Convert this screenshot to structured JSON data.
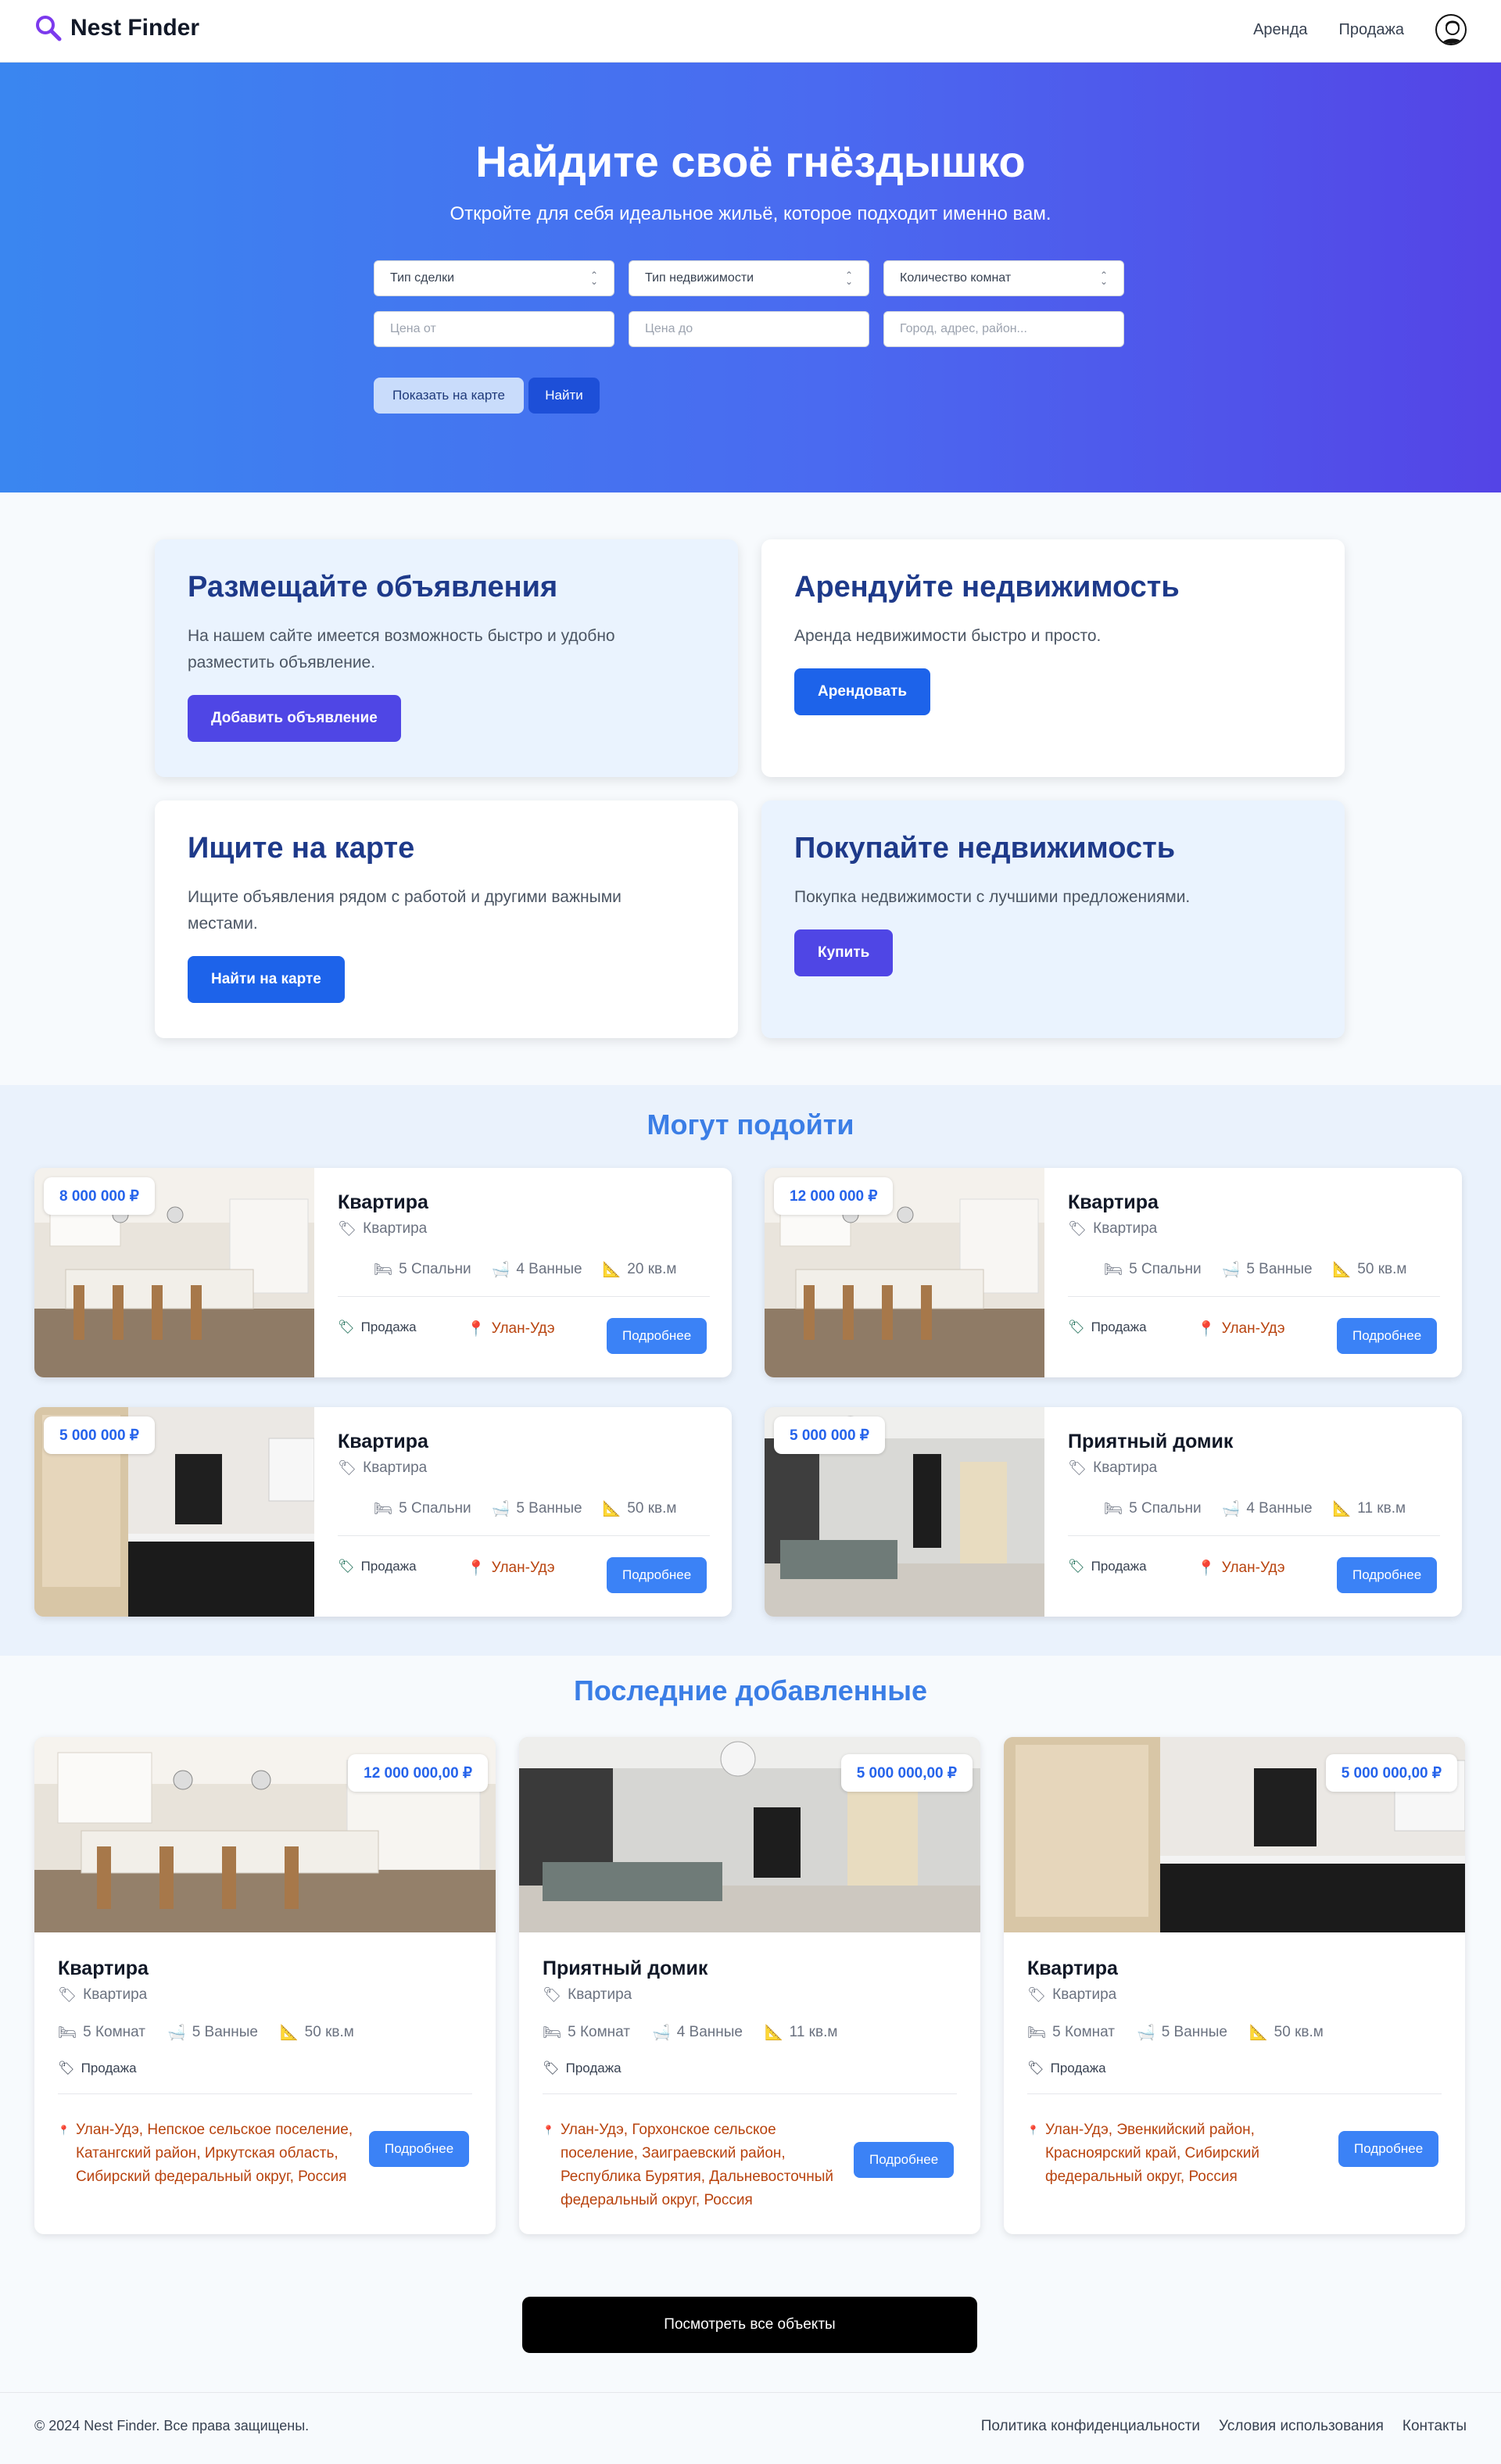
{
  "nav": {
    "logo_text": "Nest Finder",
    "links": [
      "Аренда",
      "Продажа"
    ]
  },
  "hero": {
    "title": "Найдите своё гнёздышко",
    "subtitle": "Откройте для себя идеальное жильё, которое подходит именно вам.",
    "selects": [
      "Тип сделки",
      "Тип недвижимости",
      "Количество комнат"
    ],
    "inputs": [
      "Цена от",
      "Цена до",
      "Город, адрес, район..."
    ],
    "map_button": "Показать на карте",
    "find_button": "Найти"
  },
  "promos": [
    {
      "title": "Размещайте объявления",
      "text": "На нашем сайте имеется возможность быстро и удобно разместить объявление.",
      "button": "Добавить объявление"
    },
    {
      "title": "Арендуйте недвижимость",
      "text": "Аренда недвижимости быстро и просто.",
      "button": "Арендовать"
    },
    {
      "title": "Ищите на карте",
      "text": "Ищите объявления рядом с работой и другими важными местами.",
      "button": "Найти на карте"
    },
    {
      "title": "Покупайте недвижимость",
      "text": "Покупка недвижимости с лучшими предложениями.",
      "button": "Купить"
    }
  ],
  "suggested": {
    "title": "Могут подойти",
    "cards": [
      {
        "price": "8 000 000 ₽",
        "title": "Квартира",
        "type": "Квартира",
        "bedrooms": "5 Спальни",
        "baths": "4 Ванные",
        "area": "20 кв.м",
        "deal": "Продажа",
        "city": "Улан-Удэ",
        "button": "Подробнее"
      },
      {
        "price": "12 000 000 ₽",
        "title": "Квартира",
        "type": "Квартира",
        "bedrooms": "5 Спальни",
        "baths": "5 Ванные",
        "area": "50 кв.м",
        "deal": "Продажа",
        "city": "Улан-Удэ",
        "button": "Подробнее"
      },
      {
        "price": "5 000 000 ₽",
        "title": "Квартира",
        "type": "Квартира",
        "bedrooms": "5 Спальни",
        "baths": "5 Ванные",
        "area": "50 кв.м",
        "deal": "Продажа",
        "city": "Улан-Удэ",
        "button": "Подробнее"
      },
      {
        "price": "5 000 000 ₽",
        "title": "Приятный домик",
        "type": "Квартира",
        "bedrooms": "5 Спальни",
        "baths": "4 Ванные",
        "area": "11 кв.м",
        "deal": "Продажа",
        "city": "Улан-Удэ",
        "button": "Подробнее"
      }
    ]
  },
  "latest": {
    "title": "Последние добавленные",
    "cards": [
      {
        "price": "12 000 000,00 ₽",
        "title": "Квартира",
        "type": "Квартира",
        "rooms": "5 Комнат",
        "baths": "5 Ванные",
        "area": "50 кв.м",
        "deal": "Продажа",
        "address": "Улан-Удэ, Непское сельское поселение, Катангский район, Иркутская область, Сибирский федеральный округ, Россия",
        "button": "Подробнее"
      },
      {
        "price": "5 000 000,00 ₽",
        "title": "Приятный домик",
        "type": "Квартира",
        "rooms": "5 Комнат",
        "baths": "4 Ванные",
        "area": "11 кв.м",
        "deal": "Продажа",
        "address": "Улан-Удэ, Горхонское сельское поселение, Заиграевский район, Республика Бурятия, Дальневосточный федеральный округ, Россия",
        "button": "Подробнее"
      },
      {
        "price": "5 000 000,00 ₽",
        "title": "Квартира",
        "type": "Квартира",
        "rooms": "5 Комнат",
        "baths": "5 Ванные",
        "area": "50 кв.м",
        "deal": "Продажа",
        "address": "Улан-Удэ, Эвенкийский район, Красноярский край, Сибирский федеральный округ, Россия",
        "button": "Подробнее"
      }
    ],
    "view_all": "Посмотреть все объекты"
  },
  "footer": {
    "copyright": "© 2024 Nest Finder. Все права защищены.",
    "links": [
      "Политика конфиденциальности",
      "Условия использования",
      "Контакты"
    ]
  },
  "colors": {
    "primary": "#1d63ea",
    "indigo": "#4f46e5",
    "title_blue": "#3b7ee6",
    "city": "#b8430e"
  }
}
